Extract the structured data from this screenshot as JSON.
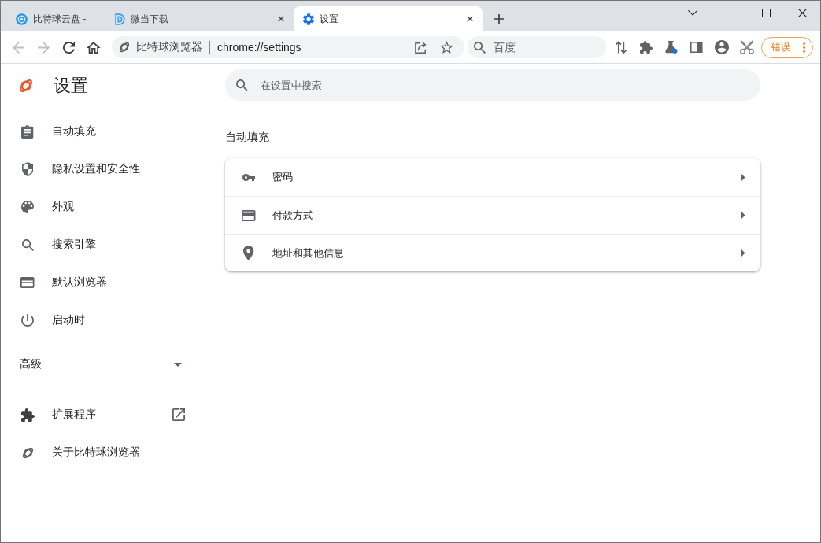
{
  "tabs": [
    {
      "title": "比特球云盘 -",
      "selected": false,
      "closable": false
    },
    {
      "title": "微当下载",
      "selected": false,
      "closable": true
    },
    {
      "title": "设置",
      "selected": true,
      "closable": true
    }
  ],
  "toolbar": {
    "nav_buttons": [
      {
        "kind": "back",
        "disabled": true
      },
      {
        "kind": "forward",
        "disabled": true
      },
      {
        "kind": "reload",
        "disabled": false
      },
      {
        "kind": "home",
        "disabled": false
      }
    ],
    "address_bar": {
      "site_name": "比特球浏览器",
      "url": "chrome://settings"
    },
    "search_box": {
      "placeholder": "百度"
    },
    "error_button": {
      "label": "错误"
    }
  },
  "sidebar": {
    "title": "设置",
    "items": [
      {
        "label": "自动填充",
        "selected": false
      },
      {
        "label": "隐私设置和安全性",
        "selected": false
      },
      {
        "label": "外观",
        "selected": false
      },
      {
        "label": "搜索引擎",
        "selected": false
      },
      {
        "label": "默认浏览器",
        "selected": false
      },
      {
        "label": "启动时",
        "selected": false
      }
    ],
    "advanced": {
      "label": "高级",
      "expanded": false
    },
    "links": [
      {
        "label": "扩展程序",
        "external": true
      },
      {
        "label": "关于比特球浏览器",
        "external": false
      }
    ]
  },
  "main": {
    "search": {
      "placeholder": "在设置中搜索"
    },
    "section": {
      "title": "自动填充",
      "rows": [
        {
          "label": "密码"
        },
        {
          "label": "付款方式"
        },
        {
          "label": "地址和其他信息"
        }
      ]
    }
  }
}
